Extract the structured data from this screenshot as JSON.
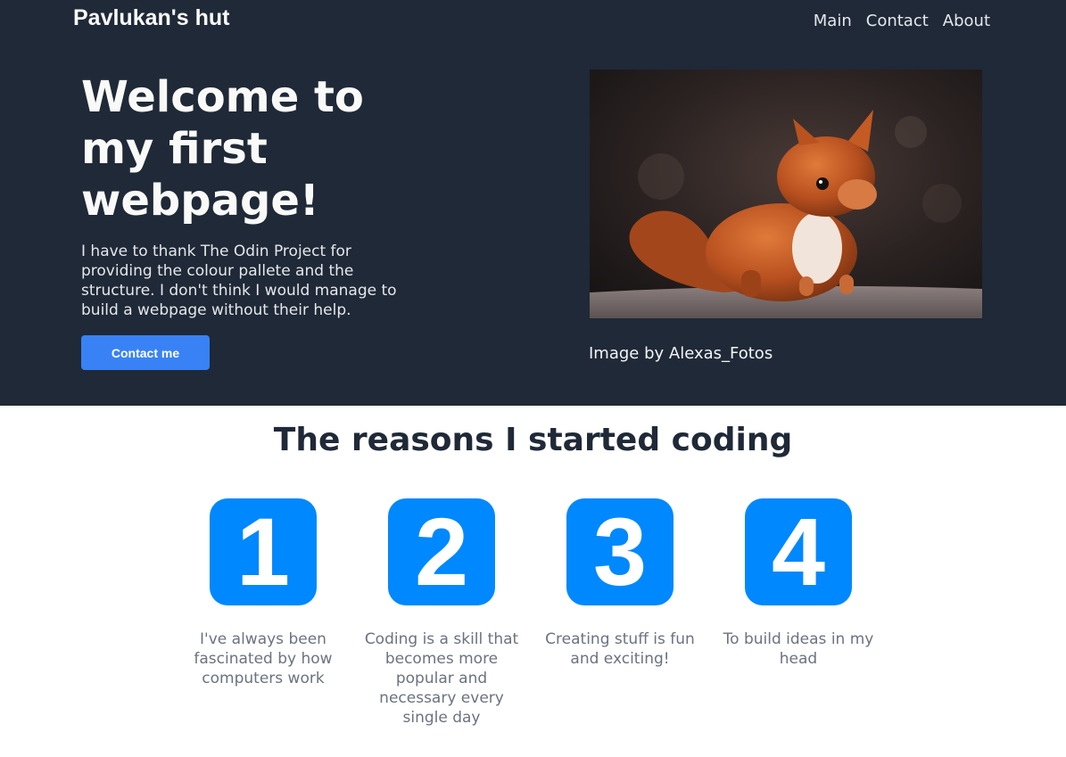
{
  "header": {
    "brand": "Pavlukan's hut",
    "nav": [
      "Main",
      "Contact",
      "About"
    ]
  },
  "hero": {
    "title": "Welcome to my first webpage!",
    "text": "I have to thank The Odin Project for providing the colour pallete and the structure. I don't think I would manage to build a webpage without their help.",
    "button_label": "Contact me",
    "image_caption": "Image by Alexas_Fotos"
  },
  "reasons": {
    "title": "The reasons I started coding",
    "items": [
      {
        "number": "1",
        "text": "I've always been fascinated by how computers work"
      },
      {
        "number": "2",
        "text": "Coding is a skill that becomes more popular and necessary every single day"
      },
      {
        "number": "3",
        "text": "Creating stuff is fun and exciting!"
      },
      {
        "number": "4",
        "text": "To build ideas in my head"
      }
    ]
  },
  "colors": {
    "hero_bg": "#1f2937",
    "accent": "#3882f6",
    "number_box": "#0088ff",
    "muted_text": "#6b7280"
  }
}
